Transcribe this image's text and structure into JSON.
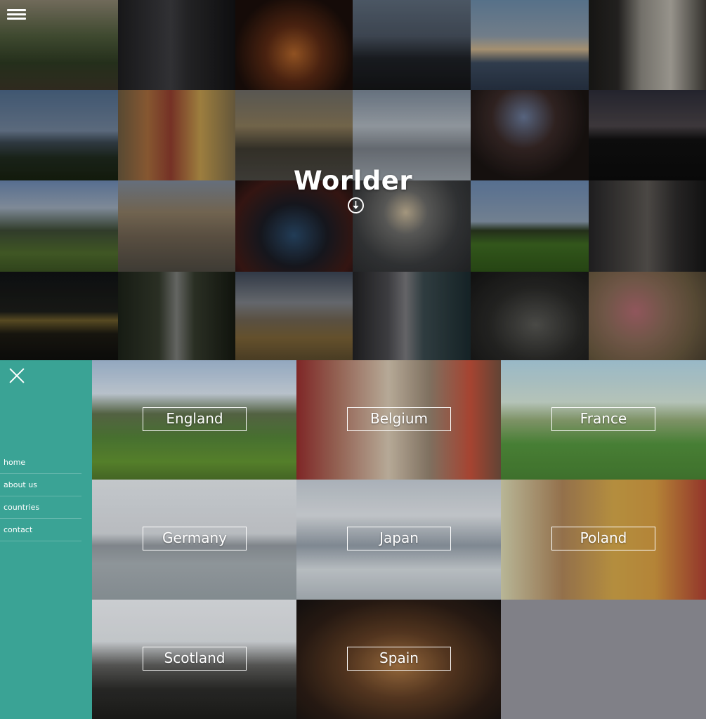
{
  "header": {
    "title": "Worlder"
  },
  "menu": {
    "items": [
      {
        "label": "home"
      },
      {
        "label": "about us"
      },
      {
        "label": "countries"
      },
      {
        "label": "contact"
      }
    ]
  },
  "countries": [
    {
      "name": "England"
    },
    {
      "name": "Belgium"
    },
    {
      "name": "France"
    },
    {
      "name": "Germany"
    },
    {
      "name": "Japan"
    },
    {
      "name": "Poland"
    },
    {
      "name": "Scotland"
    },
    {
      "name": "Spain"
    }
  ],
  "colors": {
    "menu_background": "#3aa395",
    "empty_cell": "#808087",
    "text": "#ffffff"
  },
  "icons": {
    "menu": "hamburger-icon",
    "scroll": "arrow-down-circle-icon",
    "close": "close-icon"
  }
}
